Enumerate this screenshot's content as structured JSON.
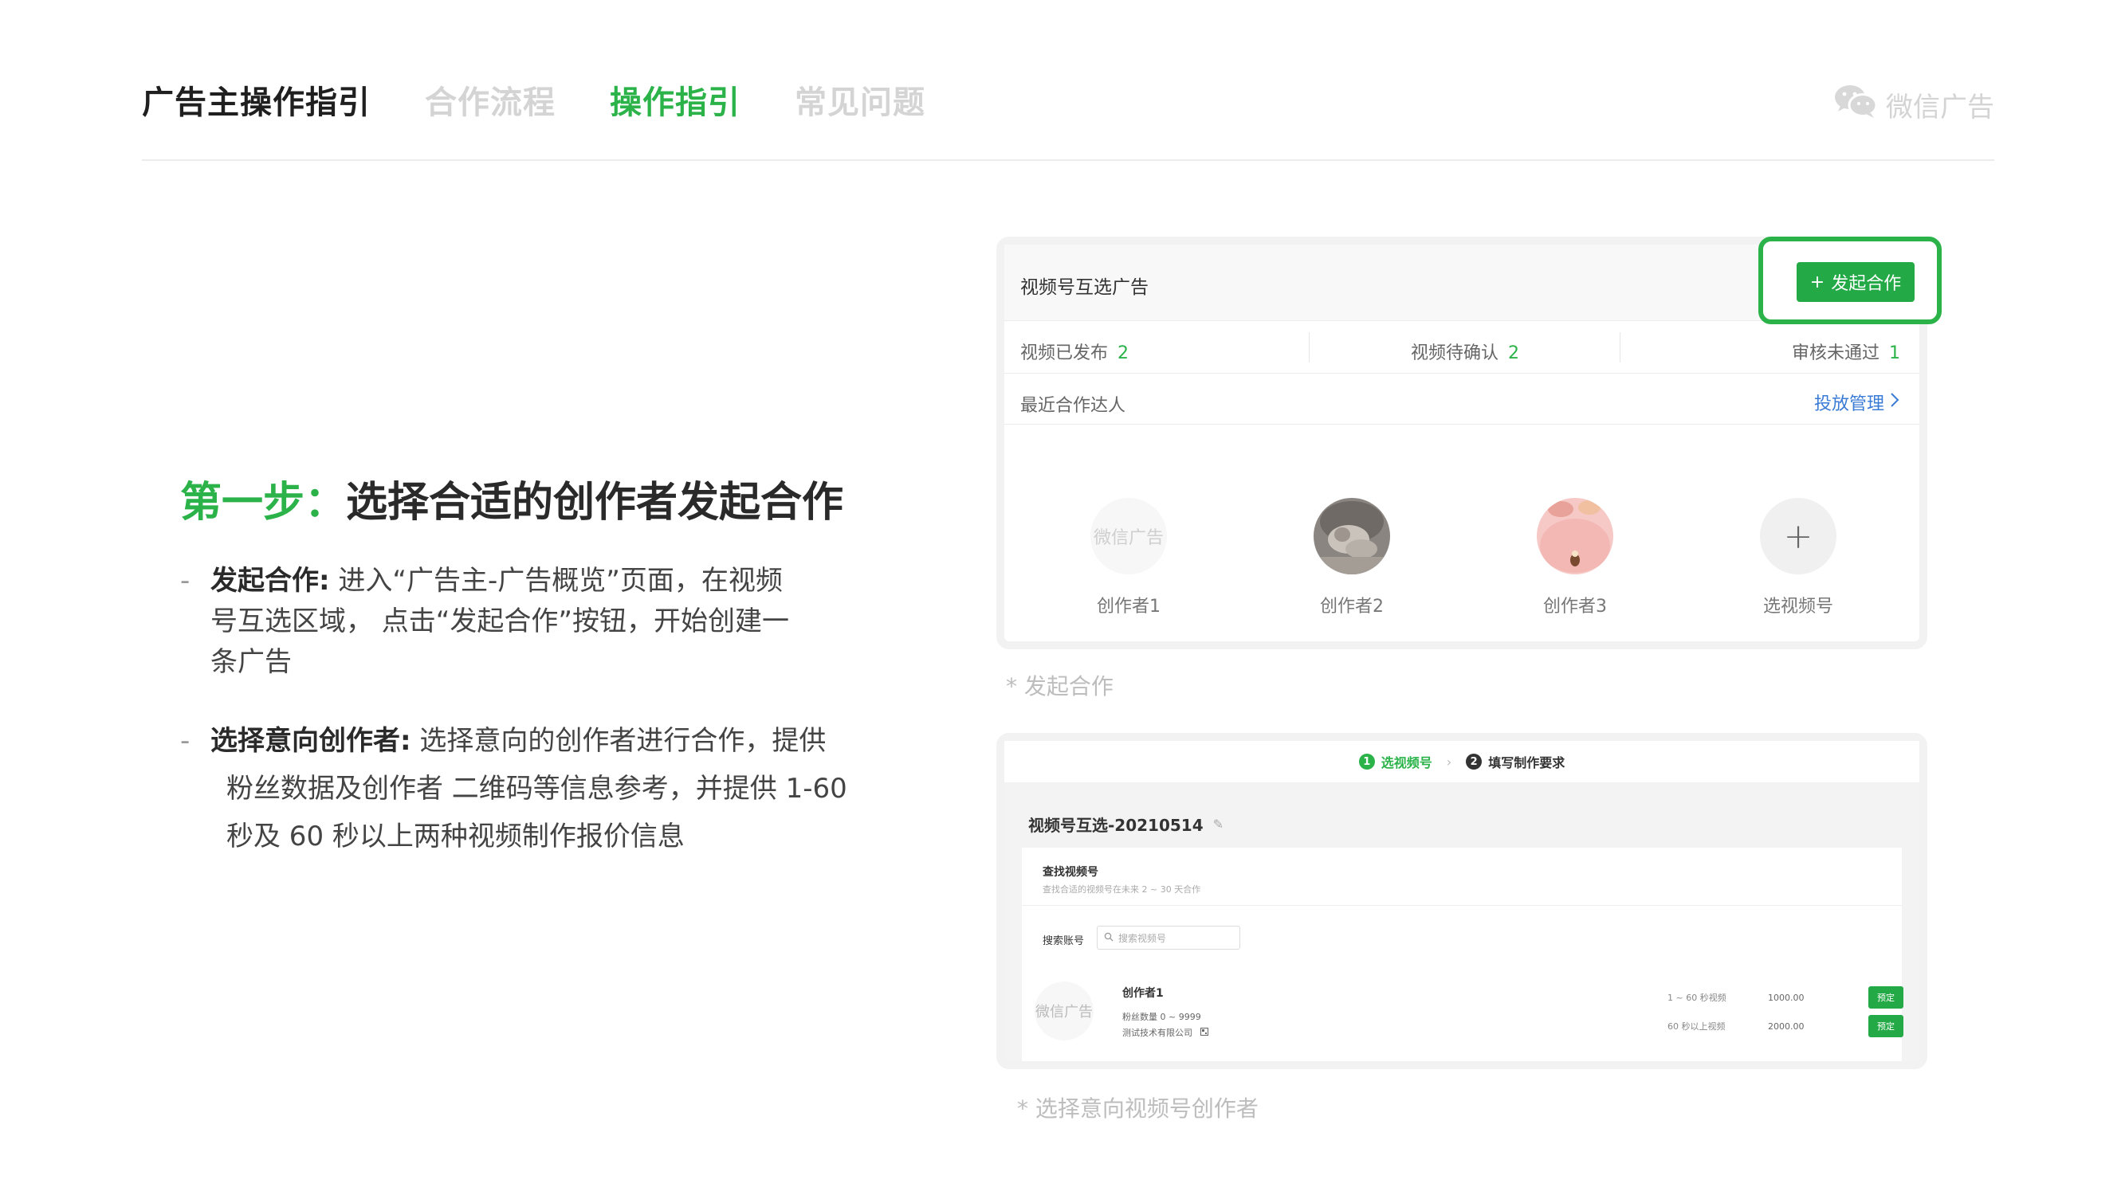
{
  "header": {
    "title": "广告主操作指引",
    "tabs": [
      {
        "label": "合作流程",
        "active": false
      },
      {
        "label": "操作指引",
        "active": true
      },
      {
        "label": "常见问题",
        "active": false
      }
    ],
    "brand": "微信广告",
    "brand_icon": "wechat-icon"
  },
  "step": {
    "prefix": "第一步：",
    "title": "选择合适的创作者发起合作"
  },
  "bullets": [
    {
      "bold": "发起合作:",
      "line1": " 进入“广告主-广告概览”页面，在视频",
      "line2": "号互选区域，  点击“发起合作”按钮，开始创建一",
      "line3": "条广告"
    },
    {
      "bold": "选择意向创作者:",
      "line1": " 选择意向的创作者进行合作，提供",
      "line2": "粉丝数据及创作者 二维码等信息参考，并提供 1-60",
      "line3": "秒及 60 秒以上两种视频制作报价信息"
    }
  ],
  "panel1": {
    "title": "视频号互选广告",
    "launch_button": "发起合作",
    "stats": [
      {
        "label": "视频已发布",
        "value": "2"
      },
      {
        "label": "视频待确认",
        "value": "2"
      },
      {
        "label": "审核未通过",
        "value": "1"
      }
    ],
    "recent_label": "最近合作达人",
    "manage_link": "投放管理",
    "creators": [
      {
        "name": "创作者1",
        "avatar_text": "微信广告"
      },
      {
        "name": "创作者2"
      },
      {
        "name": "创作者3"
      },
      {
        "name": "选视频号",
        "symbol": "+"
      }
    ],
    "caption": "* 发起合作"
  },
  "panel2": {
    "steps": [
      {
        "num": "1",
        "label": "选视频号"
      },
      {
        "num": "2",
        "label": "填写制作要求"
      }
    ],
    "campaign_name": "视频号互选-20210514",
    "find_title": "查找视频号",
    "find_sub": "查找合适的视频号在未来 2 ~ 30 天合作",
    "search_label": "搜索账号",
    "search_placeholder": "搜索视频号",
    "creator": {
      "avatar_text": "微信广告",
      "name": "创作者1",
      "fans": "粉丝数量 0 ~ 9999",
      "company": "测试技术有限公司"
    },
    "prices": [
      {
        "label": "1 ~ 60 秒视频",
        "amount": "1000.00",
        "button": "预定"
      },
      {
        "label": "60 秒以上视频",
        "amount": "2000.00",
        "button": "预定"
      }
    ],
    "caption": "* 选择意向视频号创作者"
  },
  "colors": {
    "accent_green": "#2bb34a",
    "link_blue": "#3a7bd5",
    "muted_gray": "#d4d4d4"
  }
}
